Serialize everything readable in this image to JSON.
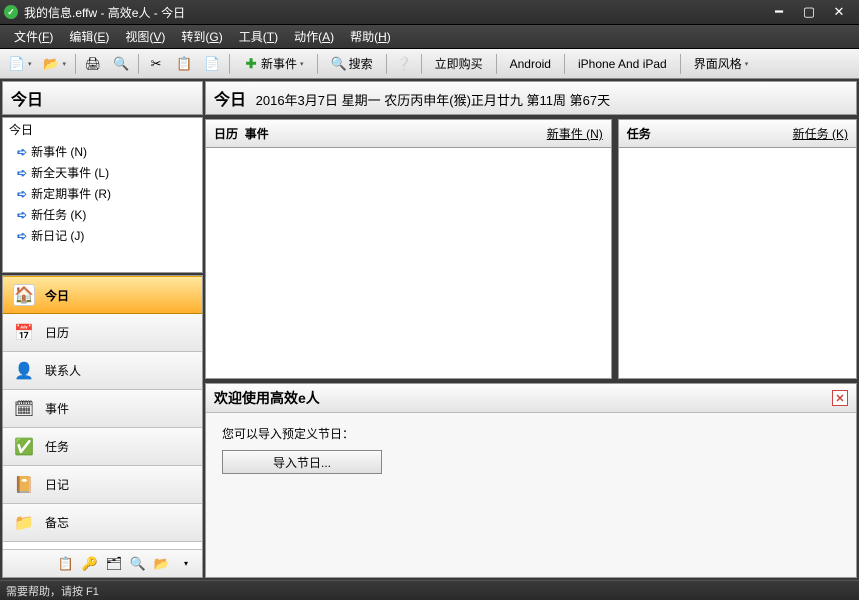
{
  "window": {
    "title": "我的信息.effw - 高效e人 - 今日"
  },
  "menu": {
    "file": "文件(",
    "file_u": "F",
    "file_end": ")",
    "edit": "编辑(",
    "edit_u": "E",
    "edit_end": ")",
    "view": "视图(",
    "view_u": "V",
    "view_end": ")",
    "goto": "转到(",
    "goto_u": "G",
    "goto_end": ")",
    "tools": "工具(",
    "tools_u": "T",
    "tools_end": ")",
    "action": "动作(",
    "action_u": "A",
    "action_end": ")",
    "help": "帮助(",
    "help_u": "H",
    "help_end": ")"
  },
  "toolbar": {
    "new_event": "新事件",
    "search": "搜索",
    "buy_now": "立即购买",
    "android": "Android",
    "iphone": "iPhone And iPad",
    "skin": "界面风格"
  },
  "leftpanel": {
    "title": "今日",
    "tree_root": "今日",
    "items": [
      "新事件 (N)",
      "新全天事件 (L)",
      "新定期事件 (R)",
      "新任务 (K)",
      "新日记 (J)"
    ],
    "nav": [
      {
        "label": "今日"
      },
      {
        "label": "日历"
      },
      {
        "label": "联系人"
      },
      {
        "label": "事件"
      },
      {
        "label": "任务"
      },
      {
        "label": "日记"
      },
      {
        "label": "备忘"
      }
    ]
  },
  "main": {
    "today_big": "今日",
    "date": "2016年3月7日 星期一 农历丙申年(猴)正月廿九  第11周 第67天",
    "cal_label": "日历",
    "event_label": "事件",
    "new_event_link": "新事件 (N)",
    "task_label": "任务",
    "new_task_link": "新任务 (K)"
  },
  "welcome": {
    "title": "欢迎使用高效e人",
    "desc": "您可以导入预定义节日：",
    "btn": "导入节日..."
  },
  "status": "需要帮助，请按 F1"
}
